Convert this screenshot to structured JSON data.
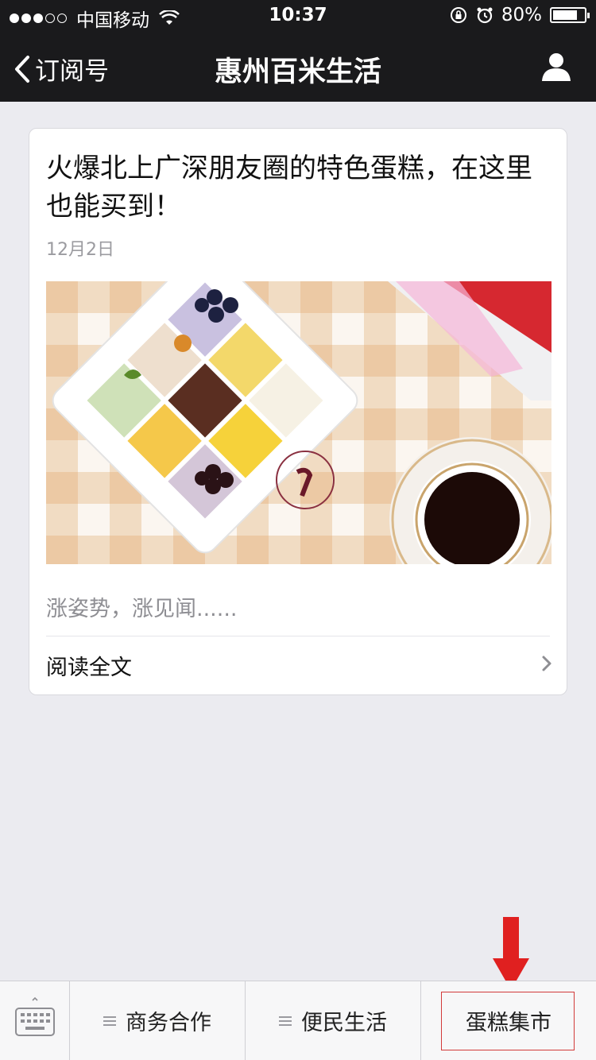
{
  "status_bar": {
    "carrier": "中国移动",
    "time": "10:37",
    "battery_text": "80%",
    "battery_level": 0.8,
    "signal_bars_filled": 3,
    "signal_bars_total": 5
  },
  "nav": {
    "back_label": "订阅号",
    "title": "惠州百米生活",
    "profile_icon": "person-icon"
  },
  "article": {
    "title": "火爆北上广深朋友圈的特色蛋糕，在这里也能买到！",
    "date": "12月2日",
    "image_alt": "cake-photo",
    "summary": "涨姿势，涨见闻......",
    "read_more": "阅读全文"
  },
  "bottom_menu": {
    "keyboard_icon": "keyboard-icon",
    "items": [
      {
        "label": "商务合作"
      },
      {
        "label": "便民生活"
      },
      {
        "label": "蛋糕集市"
      }
    ]
  },
  "colors": {
    "header_bg": "#1a1a1c",
    "page_bg": "#ebebf0",
    "annotation_red": "#e02020"
  }
}
